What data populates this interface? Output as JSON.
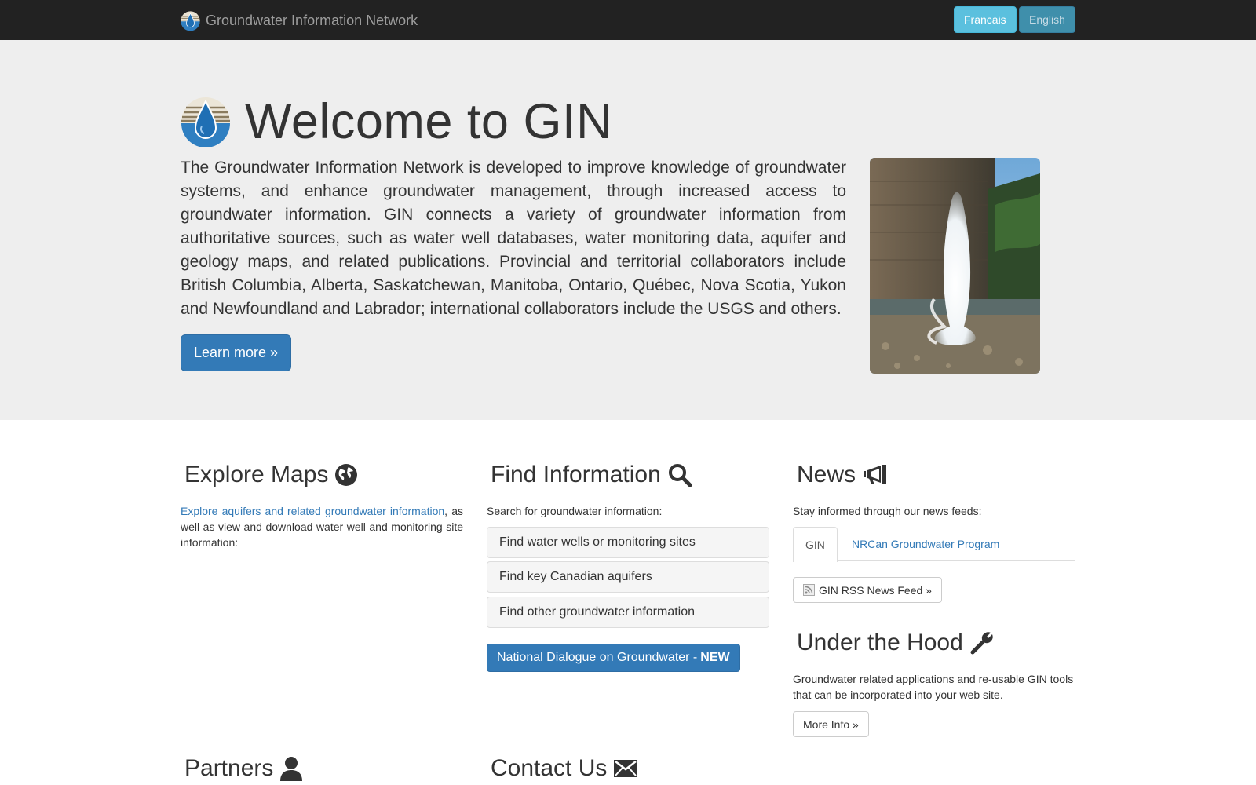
{
  "navbar": {
    "brand": "Groundwater Information Network",
    "lang_fr": "Francais",
    "lang_en": "English"
  },
  "jumbotron": {
    "title": "Welcome to GIN",
    "intro": "The Groundwater Information Network is developed to improve knowledge of groundwater systems, and enhance groundwater management, through increased access to groundwater information. GIN connects a variety of groundwater information from authoritative sources, such as water well databases, water monitoring data, aquifer and geology maps, and related publications. Provincial and territorial collaborators include British Columbia, Alberta, Saskatchewan, Manitoba, Ontario, Québec, Nova Scotia, Yukon and Newfoundland and Labrador; international collaborators include the USGS and others.",
    "learn_more": "Learn more »"
  },
  "explore": {
    "heading": "Explore Maps",
    "link_text": "Explore aquifers and related groundwater information",
    "body": ", as well as view and download water well and monitoring site information:"
  },
  "find": {
    "heading": "Find Information",
    "prompt": "Search for groundwater information:",
    "items": [
      "Find water wells or monitoring sites",
      "Find key Canadian aquifers",
      "Find other groundwater information"
    ],
    "ndg_label": "National Dialogue on Groundwater -",
    "ndg_new": "NEW"
  },
  "news": {
    "heading": "News",
    "prompt": "Stay informed through our news feeds:",
    "tabs": [
      "GIN",
      "NRCan Groundwater Program"
    ],
    "rss_button": "GIN RSS News Feed »"
  },
  "hood": {
    "heading": "Under the Hood",
    "body": "Groundwater related applications and re-usable GIN tools that can be incorporated into your web site.",
    "more_button": "More Info »"
  },
  "partners": {
    "heading": "Partners"
  },
  "contact": {
    "heading": "Contact Us"
  },
  "icons": {
    "globe": "globe-icon",
    "search": "search-icon",
    "bullhorn": "bullhorn-icon",
    "wrench": "wrench-icon",
    "user": "user-icon",
    "envelope": "envelope-icon",
    "rss": "rss-icon"
  },
  "colors": {
    "navbar": "#222222",
    "jumbotron": "#eeeeee",
    "primary": "#337ab7",
    "info": "#5bc0de"
  }
}
